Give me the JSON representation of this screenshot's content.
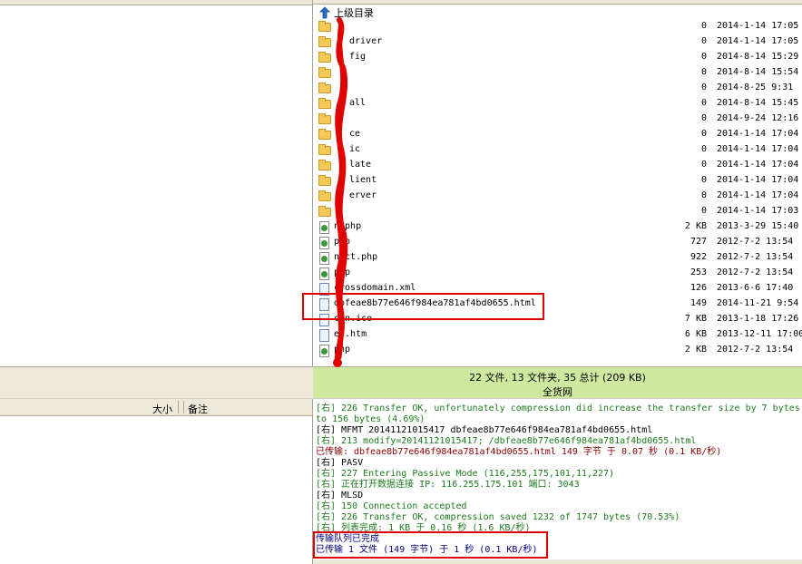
{
  "remote": {
    "parent_dir_label": "上级目录",
    "files": [
      {
        "name": "",
        "size": "0",
        "date": "2014-1-14 17:05",
        "type": "folder"
      },
      {
        "name": "driver",
        "size": "0",
        "date": "2014-1-14 17:05",
        "type": "folder"
      },
      {
        "name": "fig",
        "size": "0",
        "date": "2014-8-14 15:29",
        "type": "folder"
      },
      {
        "name": "",
        "size": "0",
        "date": "2014-8-14 15:54",
        "type": "folder"
      },
      {
        "name": "",
        "size": "0",
        "date": "2014-8-25 9:31",
        "type": "folder"
      },
      {
        "name": "all",
        "size": "0",
        "date": "2014-8-14 15:45",
        "type": "folder"
      },
      {
        "name": "",
        "size": "0",
        "date": "2014-9-24 12:16",
        "type": "folder"
      },
      {
        "name": "ce",
        "size": "0",
        "date": "2014-1-14 17:04",
        "type": "folder"
      },
      {
        "name": "ic",
        "size": "0",
        "date": "2014-1-14 17:04",
        "type": "folder"
      },
      {
        "name": "late",
        "size": "0",
        "date": "2014-1-14 17:04",
        "type": "folder"
      },
      {
        "name": "lient",
        "size": "0",
        "date": "2014-1-14 17:04",
        "type": "folder"
      },
      {
        "name": "erver",
        "size": "0",
        "date": "2014-1-14 17:04",
        "type": "folder"
      },
      {
        "name": "",
        "size": "0",
        "date": "2014-1-14 17:03",
        "type": "folder"
      },
      {
        "name": "n.php",
        "size": "2 KB",
        "date": "2013-3-29 15:40",
        "type": "php"
      },
      {
        "name": "php",
        "size": "727",
        "date": "2012-7-2 13:54",
        "type": "php"
      },
      {
        "name": "nect.php",
        "size": "922",
        "date": "2012-7-2 13:54",
        "type": "php"
      },
      {
        "name": "php",
        "size": "253",
        "date": "2012-7-2 13:54",
        "type": "php"
      },
      {
        "name": "crossdomain.xml",
        "size": "126",
        "date": "2013-6-6 17:40",
        "type": "doc"
      },
      {
        "name": "dbfeae8b77e646f984ea781af4bd0655.html",
        "size": "149",
        "date": "2014-11-21 9:54",
        "type": "doc"
      },
      {
        "name": "con.ico",
        "size": "7 KB",
        "date": "2013-1-18 17:26",
        "type": "doc"
      },
      {
        "name": "er.htm",
        "size": "6 KB",
        "date": "2013-12-11 17:00",
        "type": "doc"
      },
      {
        "name": "php",
        "size": "2 KB",
        "date": "2012-7-2 13:54",
        "type": "php"
      }
    ],
    "status_summary": "22 文件, 13 文件夹, 35 总计 (209 KB)",
    "status_site": "全货网"
  },
  "queue": {
    "col_size": "大小",
    "col_note": "备注"
  },
  "log": [
    {
      "text": "[右] 226 Transfer OK, unfortunately compression did increase the transfer size by 7 bytes",
      "color": "green"
    },
    {
      "text": "to 156 bytes (4.69%)",
      "color": "green"
    },
    {
      "text": "[右] MFMT 20141121015417 dbfeae8b77e646f984ea781af4bd0655.html",
      "color": "dark"
    },
    {
      "text": "[右] 213 modify=20141121015417; /dbfeae8b77e646f984ea781af4bd0655.html",
      "color": "green"
    },
    {
      "text": "已传输: dbfeae8b77e646f984ea781af4bd0655.html 149 字节 于 0.07 秒 (0.1 KB/秒)",
      "color": "red"
    },
    {
      "text": "[右] PASV",
      "color": "dark"
    },
    {
      "text": "[右] 227 Entering Passive Mode (116,255,175,101,11,227)",
      "color": "green"
    },
    {
      "text": "[右] 正在打开数据连接 IP: 116.255.175.101 端口: 3043",
      "color": "green"
    },
    {
      "text": "[右] MLSD",
      "color": "dark"
    },
    {
      "text": "[右] 150 Connection accepted",
      "color": "green"
    },
    {
      "text": "[右] 226 Transfer OK, compression saved 1232 of 1747 bytes (70.53%)",
      "color": "green"
    },
    {
      "text": "[右] 列表完成: 1 KB 于 0.16 秒 (1.6 KB/秒)",
      "color": "green"
    },
    {
      "text": "传输队列已完成",
      "color": "navy"
    },
    {
      "text": "已传输 1 文件 (149 字节) 于 1 秒 (0.1 KB/秒)",
      "color": "navy"
    }
  ],
  "colors": {
    "status_bar_bg": "#cfe8a0",
    "log_green": "#1b7a1b",
    "log_red": "#8b0000",
    "annotation_red": "#e10000"
  }
}
